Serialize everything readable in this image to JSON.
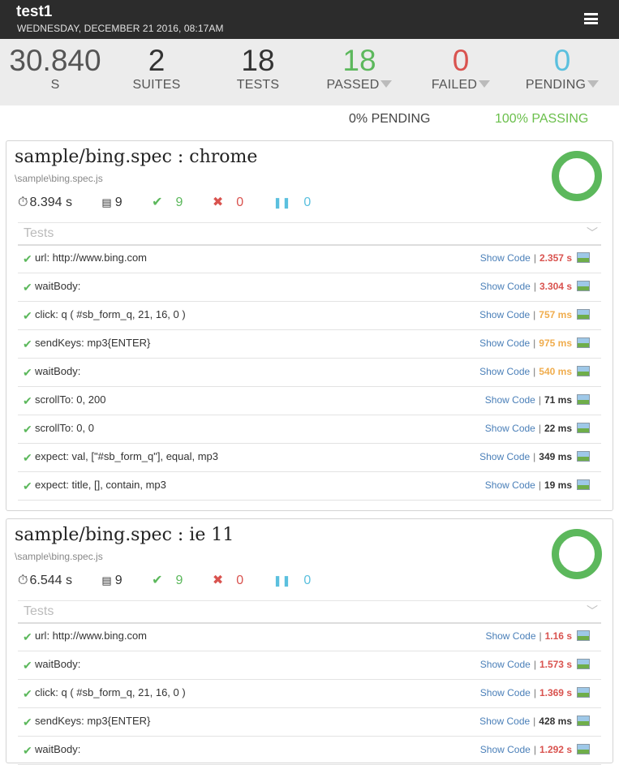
{
  "header": {
    "title": "test1",
    "date": "WEDNESDAY, DECEMBER 21 2016, 08:17AM"
  },
  "summary": {
    "duration": {
      "value": "30.840",
      "label": "S"
    },
    "suites": {
      "value": "2",
      "label": "SUITES"
    },
    "tests": {
      "value": "18",
      "label": "TESTS"
    },
    "passed": {
      "value": "18",
      "label": "PASSED",
      "color": "#5cb85c"
    },
    "failed": {
      "value": "0",
      "label": "FAILED",
      "color": "#d9534f"
    },
    "pending": {
      "value": "0",
      "label": "PENDING",
      "color": "#5bc0de"
    }
  },
  "percentages": {
    "pending": "0% PENDING",
    "passing": "100% PASSING"
  },
  "suites": [
    {
      "name": "sample/bing.spec : chrome",
      "path": "\\sample\\bing.spec.js",
      "duration": "8.394 s",
      "tests": "9",
      "passed": "9",
      "failed": "0",
      "pending": "0",
      "tests_label": "Tests",
      "rows": [
        {
          "text": "url: http://www.bing.com",
          "show": "Show Code",
          "duration": "2.357 s",
          "speed": "slow"
        },
        {
          "text": "waitBody:",
          "show": "Show Code",
          "duration": "3.304 s",
          "speed": "slow"
        },
        {
          "text": "click: q ( #sb_form_q, 21, 16, 0 )",
          "show": "Show Code",
          "duration": "757 ms",
          "speed": "med"
        },
        {
          "text": "sendKeys: mp3{ENTER}",
          "show": "Show Code",
          "duration": "975 ms",
          "speed": "med"
        },
        {
          "text": "waitBody:",
          "show": "Show Code",
          "duration": "540 ms",
          "speed": "med"
        },
        {
          "text": "scrollTo: 0, 200",
          "show": "Show Code",
          "duration": "71 ms",
          "speed": "fast"
        },
        {
          "text": "scrollTo: 0, 0",
          "show": "Show Code",
          "duration": "22 ms",
          "speed": "fast"
        },
        {
          "text": "expect: val, [\"#sb_form_q\"], equal, mp3",
          "show": "Show Code",
          "duration": "349 ms",
          "speed": "fast"
        },
        {
          "text": "expect: title, [], contain, mp3",
          "show": "Show Code",
          "duration": "19 ms",
          "speed": "fast"
        }
      ]
    },
    {
      "name": "sample/bing.spec : ie 11",
      "path": "\\sample\\bing.spec.js",
      "duration": "6.544 s",
      "tests": "9",
      "passed": "9",
      "failed": "0",
      "pending": "0",
      "tests_label": "Tests",
      "rows": [
        {
          "text": "url: http://www.bing.com",
          "show": "Show Code",
          "duration": "1.16 s",
          "speed": "slow"
        },
        {
          "text": "waitBody:",
          "show": "Show Code",
          "duration": "1.573 s",
          "speed": "slow"
        },
        {
          "text": "click: q ( #sb_form_q, 21, 16, 0 )",
          "show": "Show Code",
          "duration": "1.369 s",
          "speed": "slow"
        },
        {
          "text": "sendKeys: mp3{ENTER}",
          "show": "Show Code",
          "duration": "428 ms",
          "speed": "fast"
        },
        {
          "text": "waitBody:",
          "show": "Show Code",
          "duration": "1.292 s",
          "speed": "slow"
        }
      ]
    }
  ]
}
